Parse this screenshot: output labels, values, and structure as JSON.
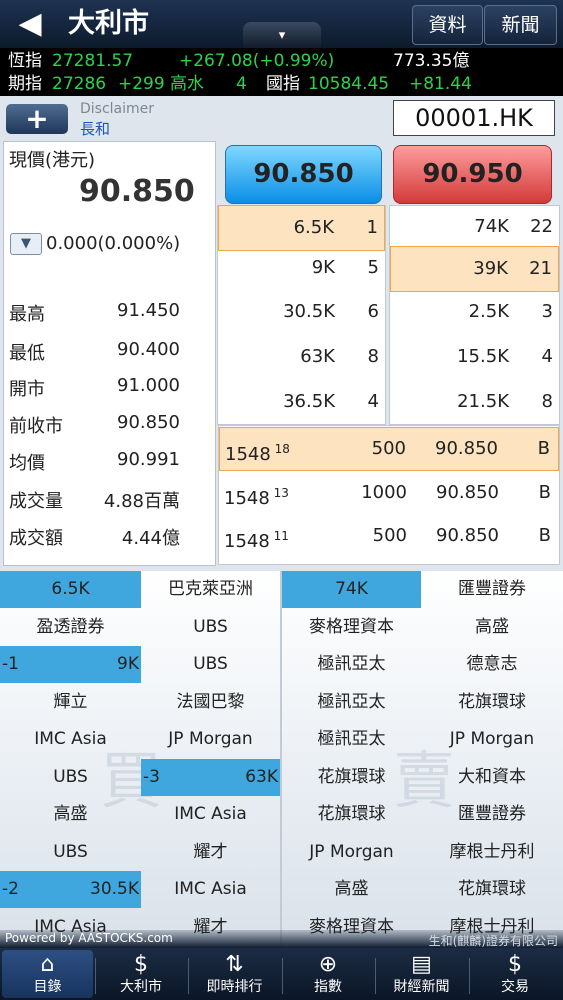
{
  "header": {
    "back_icon": "◀",
    "title": "大利市",
    "dropdown_icon": "▾",
    "info_label": "資料",
    "news_label": "新聞"
  },
  "ticker": {
    "hsi_label": "恆指",
    "hsi_value": "27281.57",
    "hsi_change": "+267.08(+0.99%)",
    "turnover": "773.35億",
    "fut_label": "期指",
    "fut_value": "27286",
    "fut_change": "+299",
    "premium_label": "高水",
    "premium_value": "4",
    "hscei_label": "國指",
    "hscei_value": "10584.45",
    "hscei_change": "+81.44"
  },
  "quote": {
    "add_icon": "+",
    "disclaimer": "Disclaimer",
    "broker": "長和",
    "code": "00001.HK",
    "price_label": "現價(港元)",
    "price": "90.850",
    "change": "0.000(0.000%)",
    "stats": [
      {
        "label": "最高",
        "value": "91.450"
      },
      {
        "label": "最低",
        "value": "90.400"
      },
      {
        "label": "開市",
        "value": "91.000"
      },
      {
        "label": "前收市",
        "value": "90.850"
      },
      {
        "label": "均價",
        "value": "90.991"
      },
      {
        "label": "成交量",
        "value": "4.88百萬"
      },
      {
        "label": "成交額",
        "value": "4.44億"
      }
    ],
    "bid": "90.850",
    "ask": "90.950"
  },
  "bid_queue": [
    {
      "vol": "6.5K",
      "num": "1"
    },
    {
      "vol": "9K",
      "num": "5"
    },
    {
      "vol": "30.5K",
      "num": "6"
    },
    {
      "vol": "63K",
      "num": "8"
    },
    {
      "vol": "36.5K",
      "num": "4"
    }
  ],
  "ask_queue": [
    {
      "vol": "74K",
      "num": "22"
    },
    {
      "vol": "39K",
      "num": "21"
    },
    {
      "vol": "2.5K",
      "num": "3"
    },
    {
      "vol": "15.5K",
      "num": "4"
    },
    {
      "vol": "21.5K",
      "num": "8"
    }
  ],
  "trades": [
    {
      "time": "1548",
      "sec": "18",
      "qty": "500",
      "price": "90.850",
      "side": "B"
    },
    {
      "time": "1548",
      "sec": "13",
      "qty": "1000",
      "price": "90.850",
      "side": "B"
    },
    {
      "time": "1548",
      "sec": "11",
      "qty": "500",
      "price": "90.850",
      "side": "B"
    }
  ],
  "brokers": {
    "buy_watermark": "買",
    "sell_watermark": "賣",
    "buy": [
      [
        "6.5K",
        "巴克萊亞洲"
      ],
      [
        "盈透證券",
        "UBS"
      ],
      [
        "-1|9K",
        "UBS"
      ],
      [
        "輝立",
        "法國巴黎"
      ],
      [
        "IMC Asia",
        "JP Morgan"
      ],
      [
        "UBS",
        "-3|63K"
      ],
      [
        "高盛",
        "IMC Asia"
      ],
      [
        "UBS",
        "耀才"
      ],
      [
        "-2|30.5K",
        "IMC Asia"
      ],
      [
        "IMC Asia",
        "耀才"
      ]
    ],
    "sell": [
      [
        "74K",
        "匯豐證券"
      ],
      [
        "麥格理資本",
        "高盛"
      ],
      [
        "極訊亞太",
        "德意志"
      ],
      [
        "極訊亞太",
        "花旗環球"
      ],
      [
        "極訊亞太",
        "JP Morgan"
      ],
      [
        "花旗環球",
        "大和資本"
      ],
      [
        "花旗環球",
        "匯豐證券"
      ],
      [
        "JP Morgan",
        "摩根士丹利"
      ],
      [
        "高盛",
        "花旗環球"
      ],
      [
        "麥格理資本",
        "摩根士丹利"
      ]
    ]
  },
  "footer": {
    "powered": "Powered by AASTOCKS.com",
    "company": "生和(麒麟)證券有限公司"
  },
  "tabs": [
    {
      "label": "目錄",
      "icon": "⌂",
      "active": true
    },
    {
      "label": "大利市",
      "icon": "$"
    },
    {
      "label": "即時排行",
      "icon": "⇅"
    },
    {
      "label": "指數",
      "icon": "⊕"
    },
    {
      "label": "財經新聞",
      "icon": "▤"
    },
    {
      "label": "交易",
      "icon": "$"
    }
  ]
}
